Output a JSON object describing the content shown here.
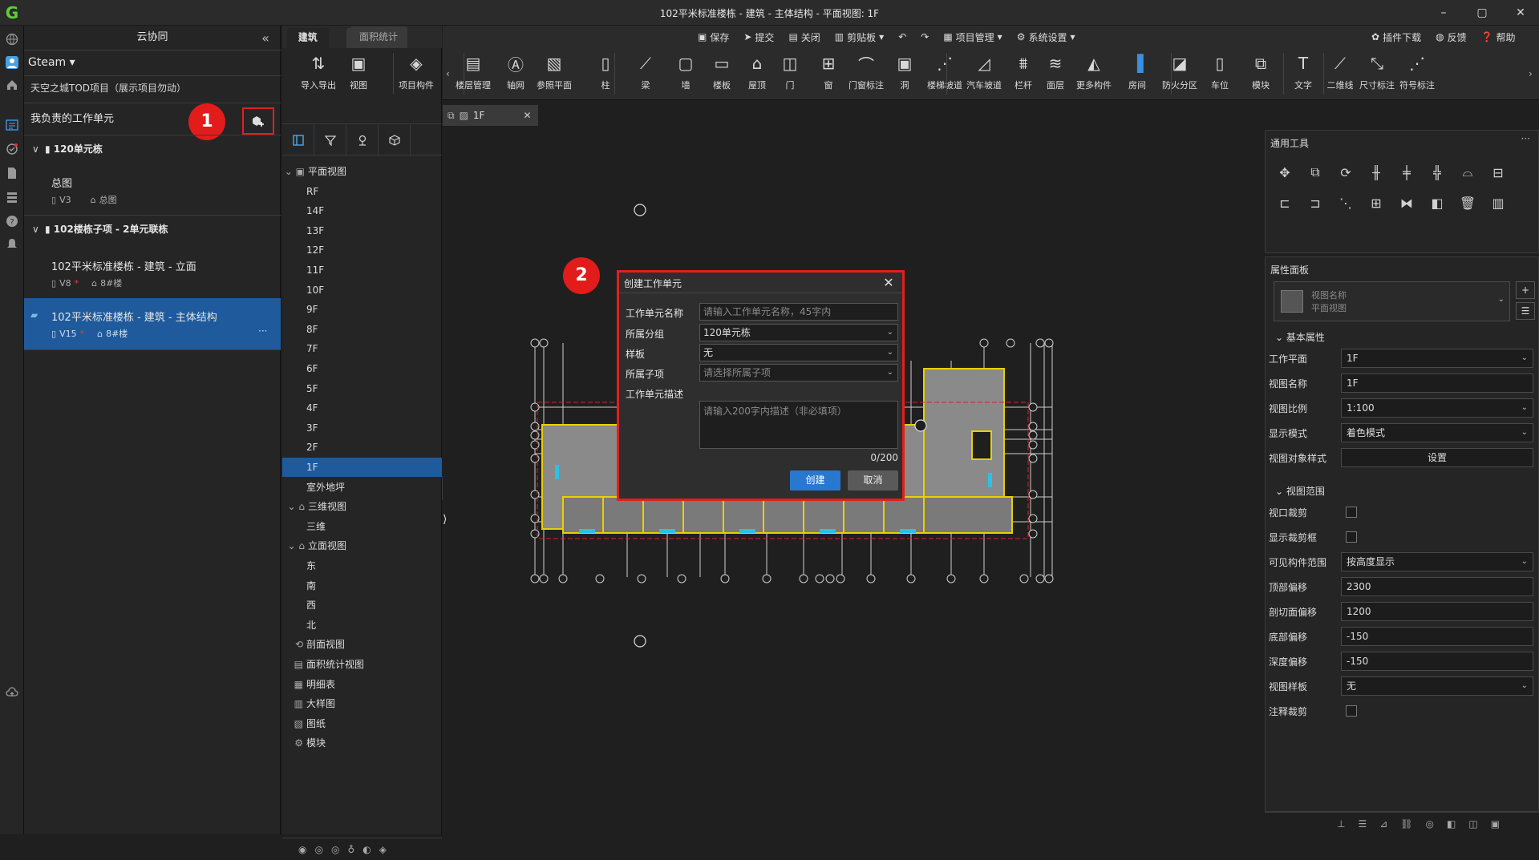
{
  "window": {
    "title": "102平米标准楼栋 - 建筑 - 主体结构 - 平面视图: 1F",
    "logo": "G"
  },
  "left_panel": {
    "header": "云协同",
    "team": "Gteam",
    "project": "天空之城TOD项目（展示项目勿动）",
    "my_units_label": "我负责的工作单元",
    "badge_1": "1",
    "groups": [
      {
        "name": "120单元栋",
        "items": [
          {
            "title": "总图",
            "version": "V3",
            "starred": false,
            "building": "总图"
          }
        ]
      },
      {
        "name": "102楼栋子项 - 2单元联栋",
        "items": [
          {
            "title": "102平米标准楼栋 - 建筑 - 立面",
            "version": "V8",
            "starred": true,
            "building": "8#楼"
          },
          {
            "title": "102平米标准楼栋 - 建筑 - 主体结构",
            "version": "V15",
            "starred": true,
            "building": "8#楼",
            "more": "···"
          }
        ]
      }
    ]
  },
  "tree_panel": {
    "tabs": [
      "建筑",
      "面积统计"
    ],
    "sections": {
      "plan": "平面视图",
      "floors": [
        "RF",
        "14F",
        "13F",
        "12F",
        "11F",
        "10F",
        "9F",
        "8F",
        "7F",
        "6F",
        "5F",
        "4F",
        "3F",
        "2F",
        "1F",
        "室外地坪"
      ],
      "three_d": "三维视图",
      "three_d_items": [
        "三维"
      ],
      "elevation": "立面视图",
      "elevation_items": [
        "东",
        "南",
        "西",
        "北"
      ],
      "others": [
        "剖面视图",
        "面积统计视图",
        "明细表",
        "大样图",
        "图纸",
        "模块"
      ]
    },
    "selected": "1F"
  },
  "top_menu": {
    "items": [
      "保存",
      "提交",
      "关闭",
      "剪贴板",
      "项目管理",
      "系统设置"
    ],
    "right": [
      "插件下载",
      "反馈",
      "帮助"
    ]
  },
  "ribbon": {
    "buttons": [
      "导入导出",
      "视图",
      "项目构件",
      "楼层管理",
      "轴网",
      "参照平面",
      "柱",
      "梁",
      "墙",
      "楼板",
      "屋顶",
      "门",
      "窗",
      "门窗标注",
      "洞",
      "楼梯坡道",
      "汽车坡道",
      "栏杆",
      "面层",
      "更多构件",
      "房间",
      "防火分区",
      "车位",
      "模块",
      "文字",
      "二维线",
      "尺寸标注",
      "符号标注"
    ]
  },
  "doc_tab": {
    "label": "1F"
  },
  "dialog": {
    "title": "创建工作单元",
    "badge_2": "2",
    "name_label": "工作单元名称",
    "name_placeholder": "请输入工作单元名称，45字内",
    "group_label": "所属分组",
    "group_value": "120单元栋",
    "template_label": "样板",
    "template_value": "无",
    "subitem_label": "所属子项",
    "subitem_placeholder": "请选择所属子项",
    "desc_label": "工作单元描述",
    "desc_placeholder": "请输入200字内描述（非必填项）",
    "counter": "0/200",
    "create": "创建",
    "cancel": "取消"
  },
  "tools_panel": {
    "title": "通用工具",
    "more": "···"
  },
  "props_panel": {
    "title": "属性面板",
    "view_name_hint": "视图名称",
    "view_type_hint": "平面视图",
    "basic_section": "基本属性",
    "range_section": "视图范围",
    "rows": [
      {
        "label": "工作平面",
        "value": "1F",
        "kind": "select"
      },
      {
        "label": "视图名称",
        "value": "1F",
        "kind": "text"
      },
      {
        "label": "视图比例",
        "value": "1:100",
        "kind": "select"
      },
      {
        "label": "显示模式",
        "value": "着色模式",
        "kind": "select"
      },
      {
        "label": "视图对象样式",
        "value": "设置",
        "kind": "button"
      }
    ],
    "range_rows": [
      {
        "label": "视口裁剪",
        "kind": "check"
      },
      {
        "label": "显示裁剪框",
        "kind": "check"
      },
      {
        "label": "可见构件范围",
        "value": "按高度显示",
        "kind": "select"
      },
      {
        "label": "顶部偏移",
        "value": "2300",
        "kind": "text"
      },
      {
        "label": "剖切面偏移",
        "value": "1200",
        "kind": "text"
      },
      {
        "label": "底部偏移",
        "value": "-150",
        "kind": "text"
      },
      {
        "label": "深度偏移",
        "value": "-150",
        "kind": "text"
      },
      {
        "label": "视图样板",
        "value": "无",
        "kind": "select"
      },
      {
        "label": "注释裁剪",
        "kind": "check"
      }
    ]
  },
  "colors": {
    "accent": "#1e5a9c",
    "highlight": "#e21b1b",
    "primary_btn": "#2878d0"
  }
}
